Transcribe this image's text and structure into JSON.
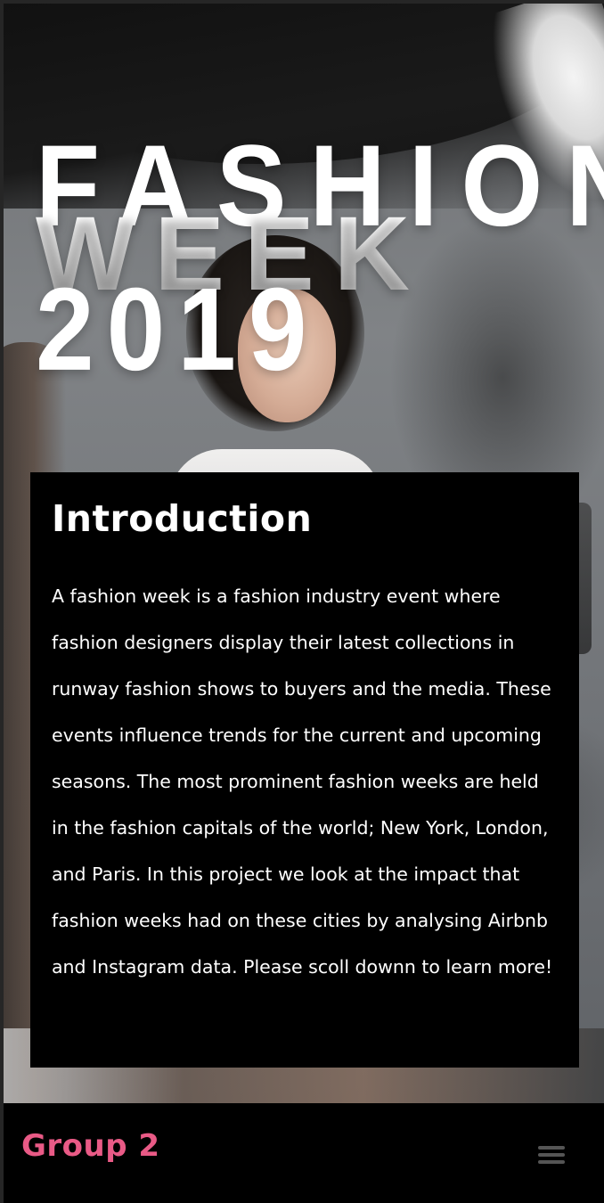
{
  "hero": {
    "title_line1": "FASHION",
    "title_line2": "WEEK",
    "title_line3": "2019"
  },
  "intro": {
    "heading": "Introduction",
    "body": "A fashion week is a fashion industry event where fashion designers display their latest collections in runway fashion shows to buyers and the media. These events influence trends for the current and upcoming seasons. The most prominent fashion weeks are held in the fashion capitals of the world; New York, London, and Paris. In this project we look at the impact that fashion weeks had on these cities by analysing Airbnb and Instagram data. Please scoll downn to learn more!"
  },
  "footer": {
    "brand": "Group 2",
    "menu_icon": "hamburger-menu-icon"
  },
  "colors": {
    "brand": "#e95a86",
    "card_bg": "#000000",
    "text": "#ffffff",
    "menu_icon": "#555555"
  }
}
